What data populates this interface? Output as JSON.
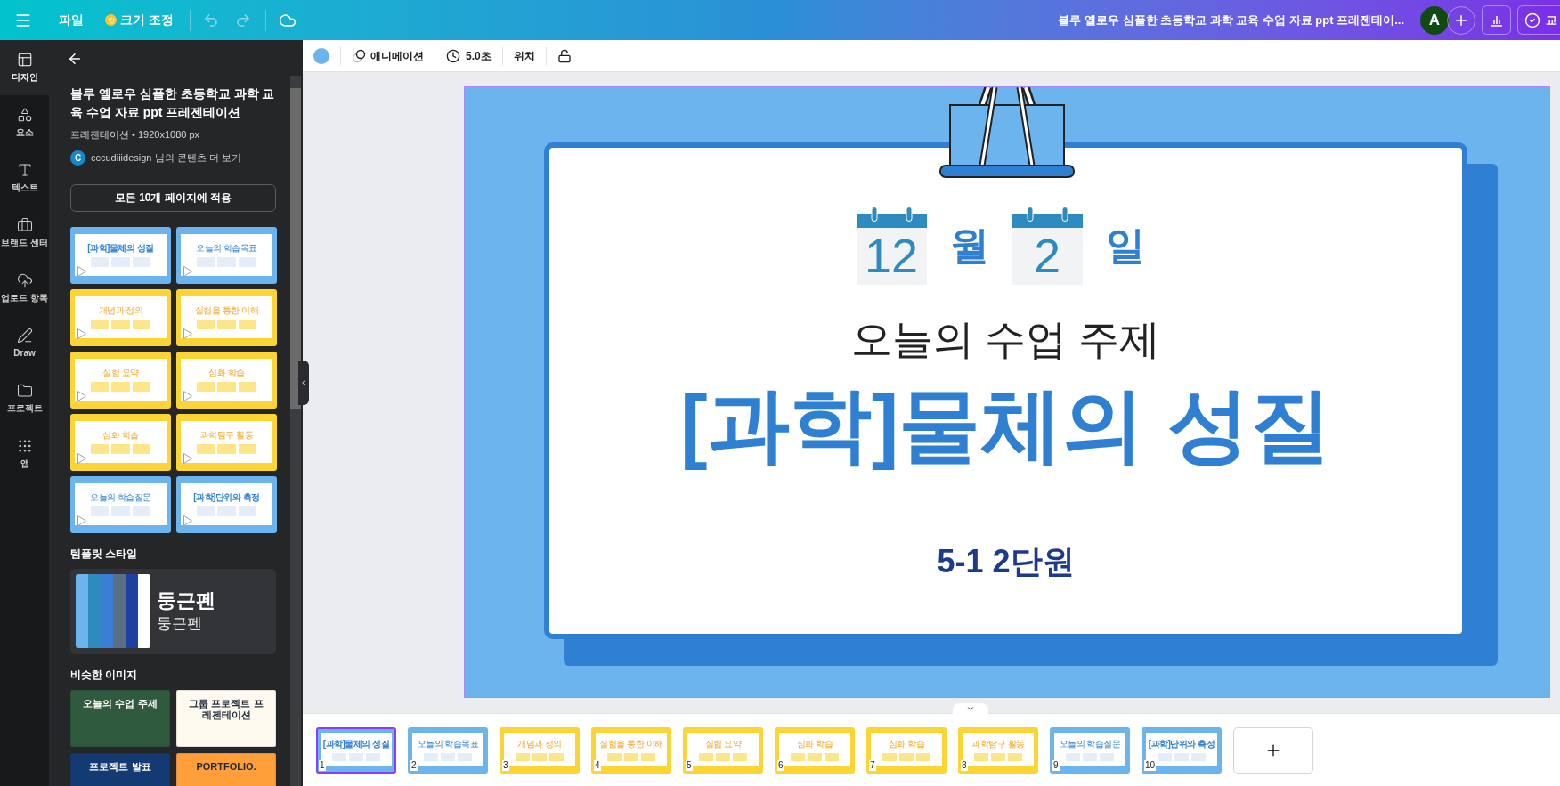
{
  "topbar": {
    "file_menu": "파일",
    "resize": "크기 조정",
    "doc_title": "블루 옐로우 심플한 초등학교 과학 교육 수업 자료 ppt 프레젠테이...",
    "avatar": "A",
    "share_button": "교"
  },
  "rail": [
    {
      "label": "디자인",
      "selected": true
    },
    {
      "label": "요소",
      "selected": false
    },
    {
      "label": "텍스트",
      "selected": false
    },
    {
      "label": "브랜드 센터",
      "selected": false
    },
    {
      "label": "업로드 항목",
      "selected": false
    },
    {
      "label": "Draw",
      "selected": false
    },
    {
      "label": "프로젝트",
      "selected": false
    },
    {
      "label": "앱",
      "selected": false
    }
  ],
  "panel": {
    "title": "블루 옐로우 심플한 초등학교 과학 교육 수업 자료 ppt 프레젠테이션",
    "meta": "프레젠테이션 • 1920x1080 px",
    "author_initial": "C",
    "author_link": "cccudiiidesign 님의 콘텐츠 더 보기",
    "apply_button": "모든 10개 페이지에 적용",
    "templates": [
      {
        "kind": "cover",
        "title": "[과학]물체의 성질"
      },
      {
        "kind": "blue",
        "title": "오늘의 학습목표"
      },
      {
        "kind": "yellow",
        "title": "개념과 정의"
      },
      {
        "kind": "yellow",
        "title": "실험을 통한 이해"
      },
      {
        "kind": "yellow",
        "title": "실험 요약"
      },
      {
        "kind": "yellow",
        "title": "심화 학습"
      },
      {
        "kind": "yellow",
        "title": "심화 학습"
      },
      {
        "kind": "yellow",
        "title": "과학탐구 활동"
      },
      {
        "kind": "blue",
        "title": "오늘의 학습질문"
      },
      {
        "kind": "cover",
        "title": "[과학]단위와 측정"
      }
    ],
    "style_heading": "템플릿 스타일",
    "style": {
      "palette": [
        {
          "color": "#6cb4ee"
        },
        {
          "color": "#2e8bc0"
        },
        {
          "color": "#3a7fd5"
        },
        {
          "color": "#5a6e85"
        },
        {
          "color": "#1e40a0"
        },
        {
          "color": "#ffffff"
        }
      ],
      "font_title": "둥근펜",
      "font_body": "둥근펜"
    },
    "similar_heading": "비슷한 이미지",
    "similar": [
      {
        "kind": "chalkboard",
        "title": "오늘의 수업 주제"
      },
      {
        "kind": "cream",
        "title": "그룹 프로젝트 프레젠테이션"
      },
      {
        "kind": "navy",
        "title": "프로젝트 발표"
      },
      {
        "kind": "orange",
        "title": "PORTFOLIO."
      }
    ]
  },
  "toolbar": {
    "color": "#6cb4ee",
    "animation": "애니메이션",
    "duration": "5.0초",
    "position": "위치"
  },
  "slide": {
    "month": "12",
    "month_unit": "월",
    "day": "2",
    "day_unit": "일",
    "subtitle": "오늘의 수업 주제",
    "title": "[과학]물체의 성질",
    "unit": "5-1 2단원"
  },
  "pages": [
    {
      "number": "1",
      "kind": "cover",
      "title": "[과학]물체의 성질",
      "selected": true
    },
    {
      "number": "2",
      "kind": "blue",
      "title": "오늘의 학습목표",
      "selected": false
    },
    {
      "number": "3",
      "kind": "yellow",
      "title": "개념과 정의",
      "selected": false
    },
    {
      "number": "4",
      "kind": "yellow",
      "title": "실험을 통한 이해",
      "selected": false
    },
    {
      "number": "5",
      "kind": "yellow",
      "title": "실험 요약",
      "selected": false
    },
    {
      "number": "6",
      "kind": "yellow",
      "title": "심화 학습",
      "selected": false
    },
    {
      "number": "7",
      "kind": "yellow",
      "title": "심화 학습",
      "selected": false
    },
    {
      "number": "8",
      "kind": "yellow",
      "title": "과학탐구 활동",
      "selected": false
    },
    {
      "number": "9",
      "kind": "blue",
      "title": "오늘의 학습질문",
      "selected": false
    },
    {
      "number": "10",
      "kind": "cover",
      "title": "[과학]단위와 측정",
      "selected": false
    }
  ]
}
